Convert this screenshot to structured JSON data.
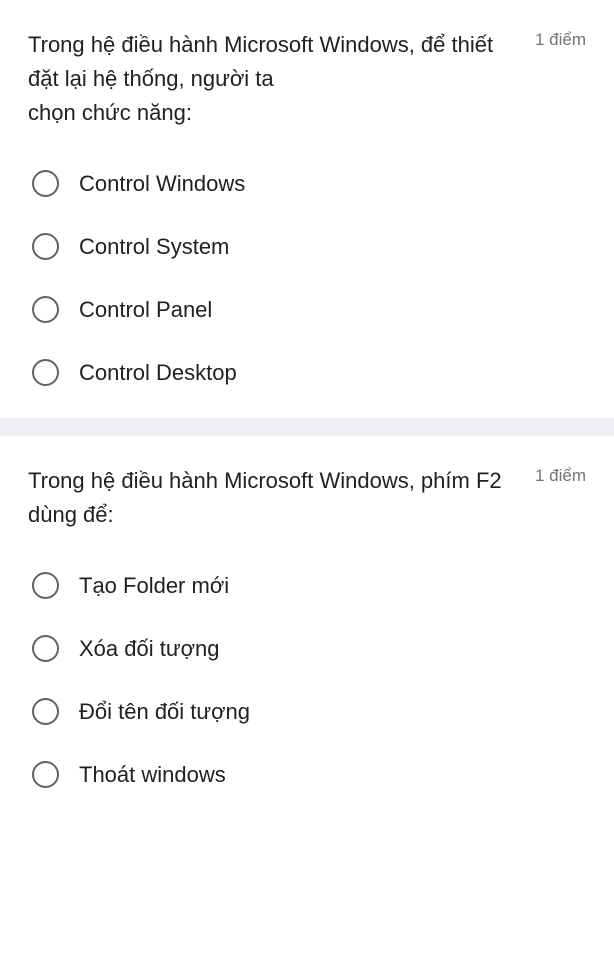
{
  "questions": [
    {
      "text": "Trong hệ điều hành Microsoft Windows, để thiết đặt lại hệ thống, người ta\n chọn chức năng:",
      "points": "1 điểm",
      "options": [
        "Control Windows",
        "Control System",
        "Control Panel",
        "Control Desktop"
      ]
    },
    {
      "text": "Trong hệ điều hành Microsoft Windows, phím F2 dùng để:",
      "points": "1 điểm",
      "options": [
        "Tạo Folder mới",
        "Xóa đối tượng",
        "Đổi tên đối tượng",
        "Thoát windows"
      ]
    }
  ]
}
